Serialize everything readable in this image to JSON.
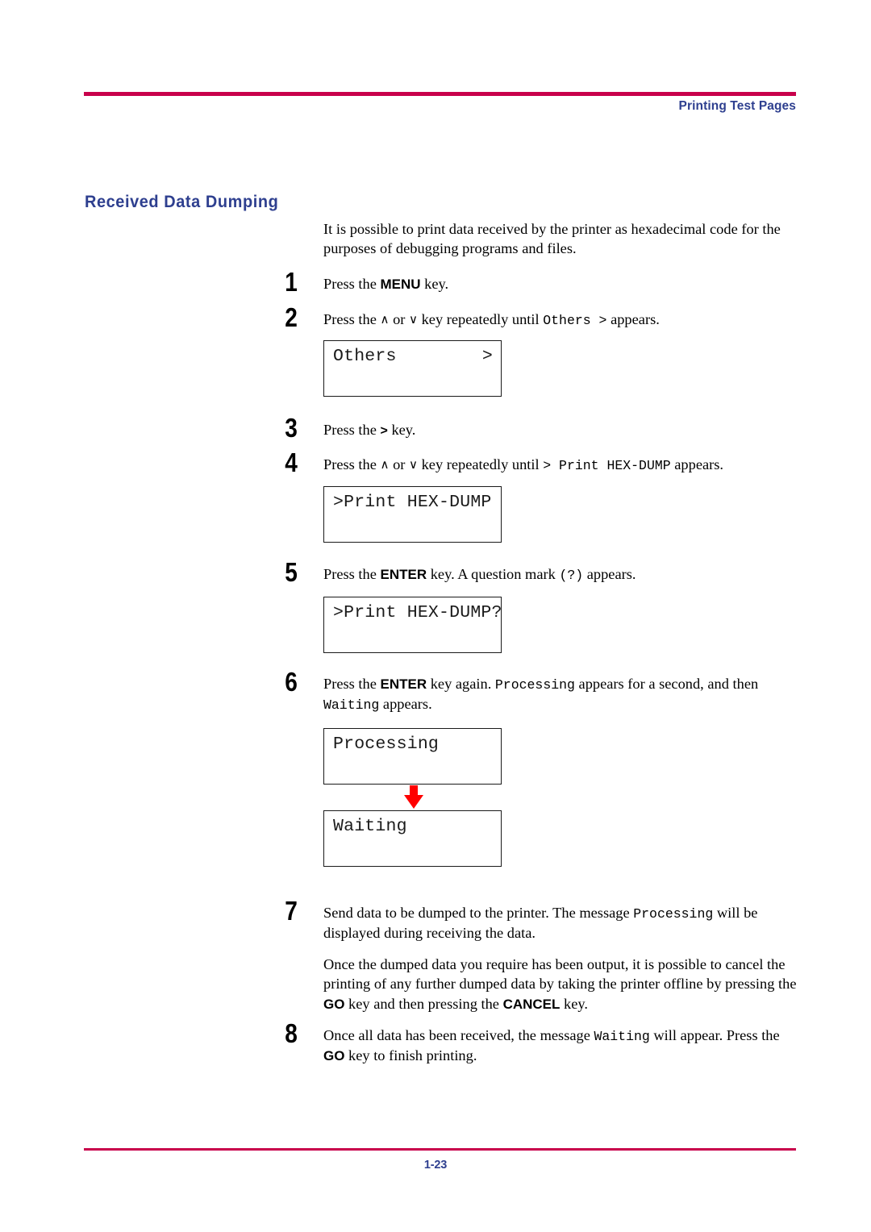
{
  "page": {
    "header_text": "Printing Test Pages",
    "section_title": "Received Data Dumping",
    "page_number": "1-23",
    "accent_rule_color": "#c8004b",
    "heading_color": "#2e3f8f"
  },
  "intro": {
    "paragraph": "It is possible to print data received by the printer as hexadecimal code for the purposes of debugging programs and files."
  },
  "steps": [
    {
      "number": "1",
      "parts": [
        {
          "type": "text",
          "value": "Press the "
        },
        {
          "type": "key",
          "value": "MENU"
        },
        {
          "type": "text",
          "value": " key."
        }
      ],
      "plain": "Press the MENU key."
    },
    {
      "number": "2",
      "parts": [
        {
          "type": "text",
          "value": "Press the "
        },
        {
          "type": "chevron",
          "value": "∧"
        },
        {
          "type": "text",
          "value": " or "
        },
        {
          "type": "chevron",
          "value": "∨"
        },
        {
          "type": "text",
          "value": " key repeatedly until "
        },
        {
          "type": "mono",
          "value": "Others"
        },
        {
          "type": "mono",
          "value": " >"
        },
        {
          "type": "text",
          "value": " appears."
        }
      ],
      "plain": "Press the ∧ or ∨ key repeatedly until Others > appears."
    },
    {
      "number": "3",
      "parts": [
        {
          "type": "text",
          "value": "Press the "
        },
        {
          "type": "gt",
          "value": ">"
        },
        {
          "type": "text",
          "value": " key."
        }
      ],
      "plain": "Press the > key."
    },
    {
      "number": "4",
      "parts": [
        {
          "type": "text",
          "value": "Press the "
        },
        {
          "type": "chevron",
          "value": "∧"
        },
        {
          "type": "text",
          "value": " or "
        },
        {
          "type": "chevron",
          "value": "∨"
        },
        {
          "type": "text",
          "value": " key repeatedly until "
        },
        {
          "type": "mono",
          "value": "> Print HEX-DUMP"
        },
        {
          "type": "text",
          "value": " appears."
        }
      ],
      "plain": "Press the ∧ or ∨ key repeatedly until > Print HEX-DUMP appears."
    },
    {
      "number": "5",
      "parts": [
        {
          "type": "text",
          "value": "Press the "
        },
        {
          "type": "key",
          "value": "ENTER"
        },
        {
          "type": "text",
          "value": " key. A question mark "
        },
        {
          "type": "mono",
          "value": "(?)"
        },
        {
          "type": "text",
          "value": " appears."
        }
      ],
      "plain": "Press the ENTER key. A question mark (?) appears."
    },
    {
      "number": "6",
      "parts": [
        {
          "type": "text",
          "value": "Press the "
        },
        {
          "type": "key",
          "value": "ENTER"
        },
        {
          "type": "text",
          "value": " key again. "
        },
        {
          "type": "mono",
          "value": "Processing"
        },
        {
          "type": "text",
          "value": " appears for a second, and then "
        },
        {
          "type": "mono",
          "value": "Waiting"
        },
        {
          "type": "text",
          "value": " appears."
        }
      ],
      "plain": "Press the ENTER key again. Processing appears for a second, and then Waiting appears."
    },
    {
      "number": "7",
      "parts": [
        {
          "type": "text",
          "value": "Send data to be dumped to the printer. The message "
        },
        {
          "type": "mono",
          "value": "Processing"
        },
        {
          "type": "text",
          "value": " will be displayed during receiving the data."
        }
      ],
      "plain": "Send data to be dumped to the printer. The message Processing will be displayed during receiving the data."
    },
    {
      "number": "8",
      "parts": [
        {
          "type": "text",
          "value": "Once all data has been received, the message "
        },
        {
          "type": "mono",
          "value": "Waiting"
        },
        {
          "type": "text",
          "value": " will appear. Press the "
        },
        {
          "type": "key",
          "value": "GO"
        },
        {
          "type": "text",
          "value": " key to finish printing."
        }
      ],
      "plain": "Once all data has been received, the message Waiting will appear. Press the GO key to finish printing."
    }
  ],
  "note_paragraph": {
    "parts": [
      {
        "type": "text",
        "value": "Once the dumped data you require has been output, it is possible to cancel the printing of any further dumped data by taking the printer offline by pressing the "
      },
      {
        "type": "key",
        "value": "GO"
      },
      {
        "type": "text",
        "value": " key and then pressing the "
      },
      {
        "type": "key",
        "value": "CANCEL"
      },
      {
        "type": "text",
        "value": " key."
      }
    ],
    "plain": "Once the dumped data you require has been output, it is possible to cancel the printing of any further dumped data by taking the printer offline by pressing the GO key and then pressing the CANCEL key."
  },
  "lcd_displays": [
    {
      "id": "others",
      "left": "Others",
      "right": ">"
    },
    {
      "id": "print-hex-dump",
      "left": ">Print HEX-DUMP",
      "right": ""
    },
    {
      "id": "print-hex-dump-confirm",
      "left": ">Print HEX-DUMP?",
      "right": ""
    },
    {
      "id": "processing",
      "left": "Processing",
      "right": ""
    },
    {
      "id": "waiting",
      "left": "Waiting",
      "right": ""
    }
  ],
  "arrow": {
    "direction": "down",
    "color": "#ff0000"
  }
}
